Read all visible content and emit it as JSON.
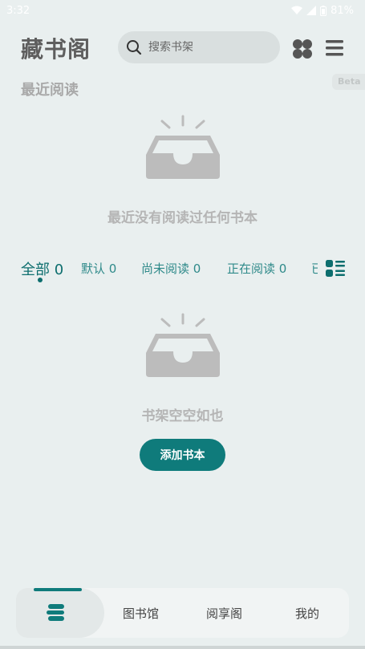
{
  "status_bar": {
    "time": "3:32",
    "battery": "81%"
  },
  "header": {
    "title": "藏书阁",
    "search_placeholder": "搜索书架"
  },
  "recent": {
    "title": "最近阅读",
    "beta": "Beta",
    "empty_text": "最近没有阅读过任何书本"
  },
  "tabs": [
    {
      "label": "全部",
      "count": "0"
    },
    {
      "label": "默认",
      "count": "0"
    },
    {
      "label": "尚未阅读",
      "count": "0"
    },
    {
      "label": "正在阅读",
      "count": "0"
    },
    {
      "label": "已"
    }
  ],
  "shelf": {
    "empty_text": "书架空空如也",
    "add_button": "添加书本"
  },
  "bottom_nav": {
    "items": [
      "图书馆",
      "阅享阁",
      "我的"
    ]
  },
  "colors": {
    "accent": "#0f7b7b",
    "background": "#e9efef",
    "muted": "#b5b5b5"
  }
}
